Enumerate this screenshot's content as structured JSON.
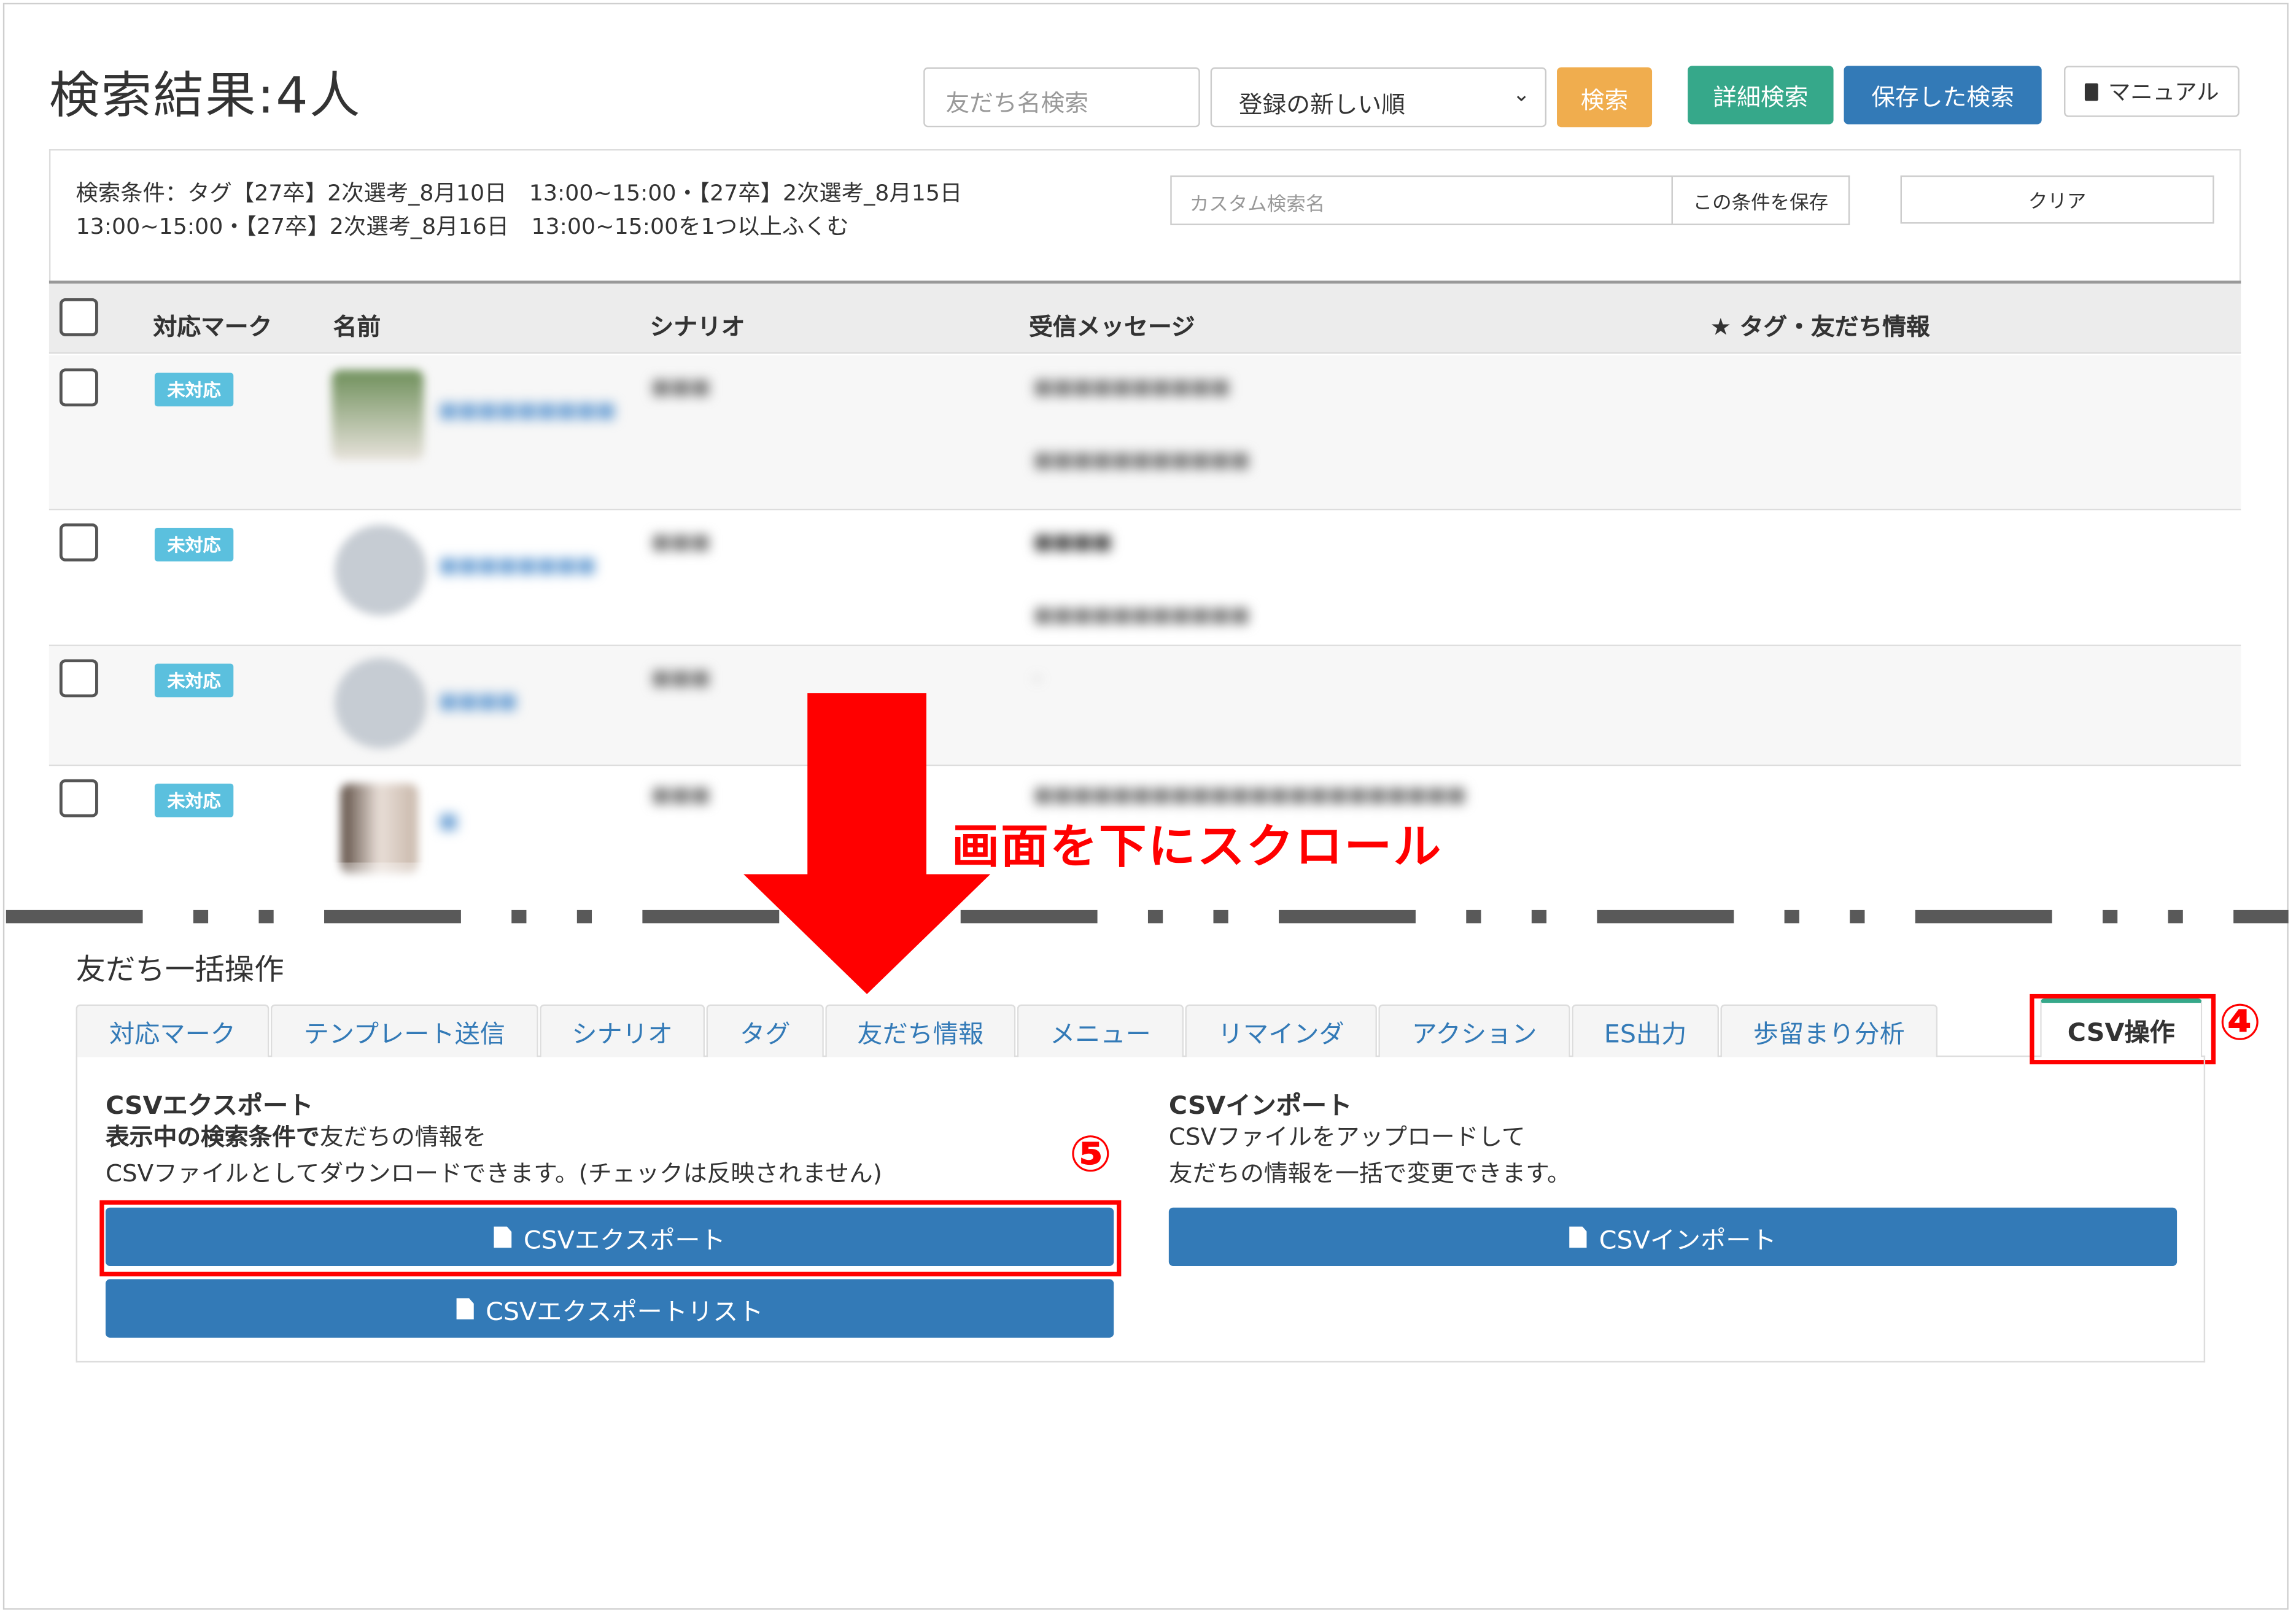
{
  "header": {
    "title": "検索結果:4人",
    "search_placeholder": "友だち名検索",
    "sort_selected": "登録の新しい順",
    "search_button": "検索",
    "advanced_search_button": "詳細検索",
    "saved_search_button": "保存した検索",
    "manual_button": "マニュアル"
  },
  "conditions": {
    "line1": "検索条件：タグ【27卒】2次選考_8月10日　13:00~15:00・【27卒】2次選考_8月15日",
    "line2": "13:00~15:00・【27卒】2次選考_8月16日　13:00~15:00を1つ以上ふくむ",
    "custom_name_placeholder": "カスタム検索名",
    "save_condition_button": "この条件を保存",
    "clear_button": "クリア"
  },
  "table": {
    "columns": [
      "対応マーク",
      "名前",
      "シナリオ",
      "受信メッセージ",
      "★ タグ・友だち情報"
    ],
    "rows": [
      {
        "badge": "未対応"
      },
      {
        "badge": "未対応"
      },
      {
        "badge": "未対応"
      },
      {
        "badge": "未対応"
      }
    ]
  },
  "annotation": {
    "scroll_text": "画面を下にスクロール",
    "marker_4": "④",
    "marker_5": "⑤",
    "color": "#ff0000"
  },
  "bulk": {
    "title": "友だち一括操作",
    "tabs": [
      "対応マーク",
      "テンプレート送信",
      "シナリオ",
      "タグ",
      "友だち情報",
      "メニュー",
      "リマインダ",
      "アクション",
      "ES出力",
      "歩留まり分析",
      "CSV操作"
    ],
    "active_tab": "CSV操作",
    "export": {
      "heading": "CSVエクスポート",
      "desc_bold": "表示中の検索条件で",
      "desc_rest": "友だちの情報を",
      "desc_line2": "CSVファイルとしてダウンロードできます。(チェックは反映されません)",
      "button": "CSVエクスポート",
      "list_button": "CSVエクスポートリスト"
    },
    "import": {
      "heading": "CSVインポート",
      "desc_line1": "CSVファイルをアップロードして",
      "desc_line2": "友だちの情報を一括で変更できます。",
      "button": "CSVインポート"
    }
  },
  "colors": {
    "primary": "#337ab7",
    "success": "#36a88a",
    "warning": "#f0ad4e",
    "badge": "#5bc0de"
  }
}
